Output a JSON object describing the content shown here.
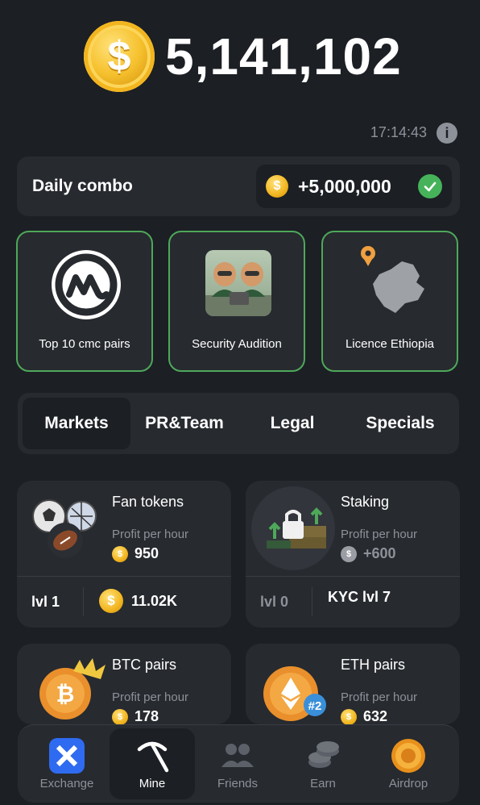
{
  "balance": {
    "value": "5,141,102",
    "coin_symbol": "$"
  },
  "header": {
    "time": "17:14:43",
    "info_symbol": "i"
  },
  "daily_combo": {
    "label": "Daily combo",
    "reward": "+5,000,000",
    "coin_symbol": "$"
  },
  "combo_cards": [
    {
      "label": "Top 10 cmc pairs",
      "icon": "coinmarketcap-icon"
    },
    {
      "label": "Security Audition",
      "icon": "hamsters-image"
    },
    {
      "label": "Licence Ethiopia",
      "icon": "ethiopia-map-icon"
    }
  ],
  "tabs": [
    "Markets",
    "PR&Team",
    "Legal",
    "Specials"
  ],
  "active_tab": "Markets",
  "upgrades": [
    {
      "title": "Fan tokens",
      "pph_label": "Profit per hour",
      "profit": "950",
      "level": "lvl 1",
      "cost": "11.02K",
      "icon": "sports-balls-icon"
    },
    {
      "title": "Staking",
      "pph_label": "Profit per hour",
      "profit": "+600",
      "level": "lvl 0",
      "cost": "KYC lvl 7",
      "icon": "staking-lock-icon"
    },
    {
      "title": "BTC pairs",
      "pph_label": "Profit per hour",
      "profit": "178",
      "icon": "btc-coin-icon"
    },
    {
      "title": "ETH pairs",
      "pph_label": "Profit per hour",
      "profit": "632",
      "icon": "eth-coin-icon",
      "badge": "#2"
    }
  ],
  "nav": [
    {
      "label": "Exchange",
      "icon": "exchange-icon"
    },
    {
      "label": "Mine",
      "icon": "pickaxe-icon"
    },
    {
      "label": "Friends",
      "icon": "friends-icon"
    },
    {
      "label": "Earn",
      "icon": "coins-stack-icon"
    },
    {
      "label": "Airdrop",
      "icon": "airdrop-coin-icon"
    }
  ],
  "active_nav": "Mine",
  "colors": {
    "background": "#1c1f24",
    "card": "#272a2f",
    "accent_green": "#4ea85a",
    "coin_gold": "#f2b51f",
    "muted": "#8d9199"
  }
}
